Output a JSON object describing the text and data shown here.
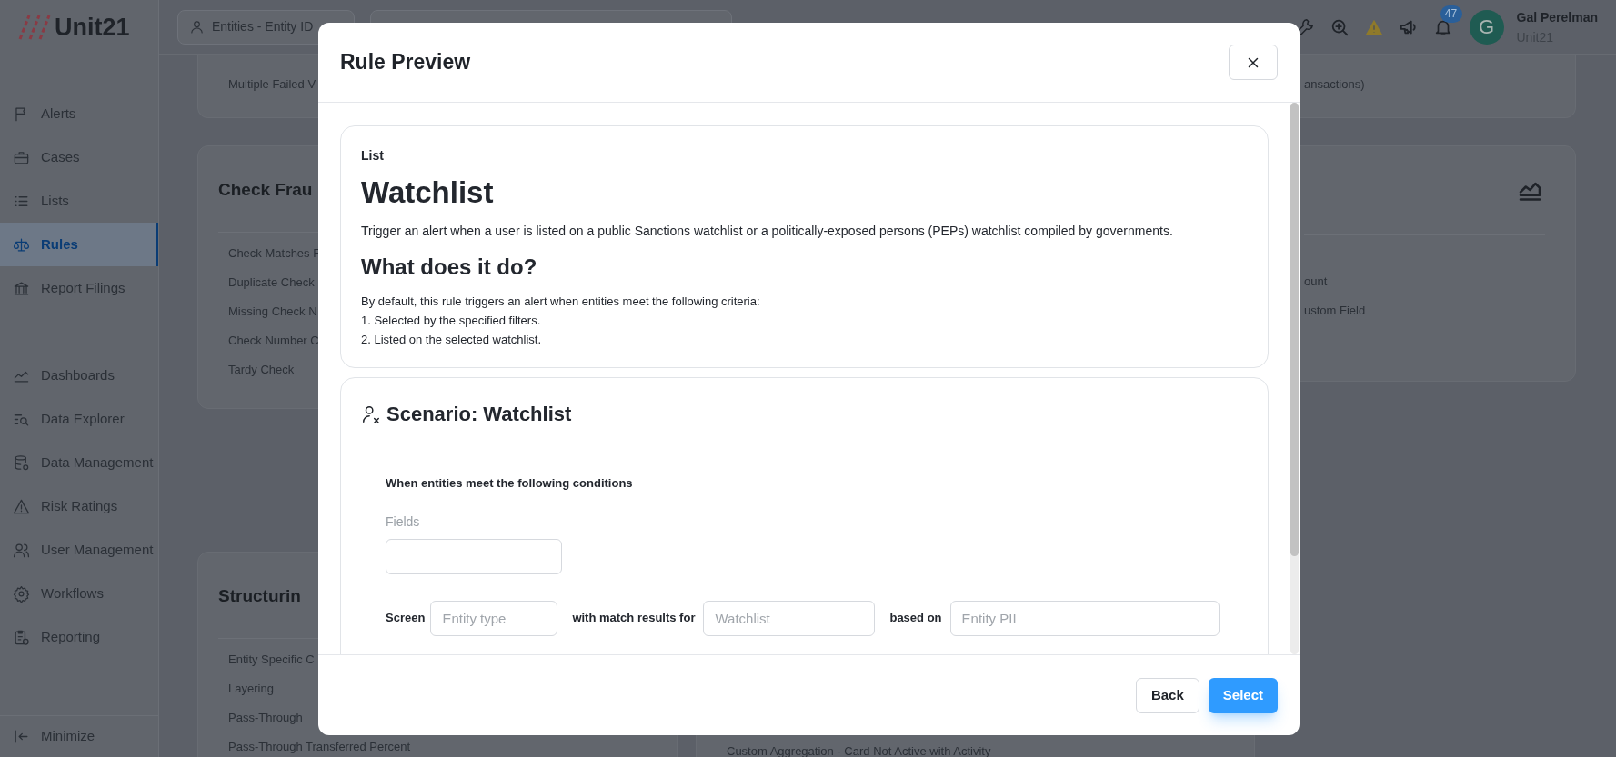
{
  "logo": {
    "text": "Unit21"
  },
  "sidebar": {
    "sections": [
      [
        {
          "label": "Alerts",
          "selected": false
        },
        {
          "label": "Cases",
          "selected": false
        },
        {
          "label": "Lists",
          "selected": false
        },
        {
          "label": "Rules",
          "selected": true
        },
        {
          "label": "Report Filings",
          "selected": false
        }
      ],
      [
        {
          "label": "Dashboards",
          "selected": false
        },
        {
          "label": "Data Explorer",
          "selected": false
        },
        {
          "label": "Data Management",
          "selected": false
        },
        {
          "label": "Risk Ratings",
          "selected": false
        },
        {
          "label": "User Management",
          "selected": false
        },
        {
          "label": "Workflows",
          "selected": false
        },
        {
          "label": "Reporting",
          "selected": false
        }
      ]
    ],
    "footer": {
      "label": "Minimize"
    }
  },
  "top_bar": {
    "entity_selector": {
      "label": "Entities - Entity ID"
    },
    "notifications": {
      "badge": "47"
    },
    "user": {
      "initial": "G",
      "name": "Gal Perelman",
      "organization": "Unit21"
    }
  },
  "background": {
    "columns": [
      {
        "cards": [
          {
            "items": [
              "Multiple Failed V"
            ]
          },
          {
            "title": "Check Frau",
            "items": [
              "Check Matches F",
              "Duplicate Check",
              "Missing Check N",
              "Check Number C",
              "Tardy Check"
            ]
          },
          {
            "title": "Structurin",
            "items": [
              "Entity Specific C",
              "Layering",
              "Pass-Through",
              "Pass-Through Transferred Percent"
            ]
          }
        ]
      },
      {
        "cards": [
          {
            "items": [
              "Custom Aggregation - Card Not Active with Activity"
            ]
          }
        ]
      },
      {
        "cards": [
          {
            "items": [
              "ansactions)"
            ]
          },
          {
            "items": [
              "ount",
              "ustom Field"
            ]
          }
        ]
      }
    ]
  },
  "modal": {
    "title": "Rule Preview",
    "sections": [
      {
        "kind": "description",
        "eyebrow": "List",
        "title": "Watchlist",
        "summary": "Trigger an alert when a user is listed on a public Sanctions watchlist or a politically-exposed persons (PEPs) watchlist compiled by governments.",
        "subtitle": "What does it do?",
        "lines": [
          "By default, this rule triggers an alert when entities meet the following criteria:",
          "1. Selected by the specified filters.",
          "2. Listed on the selected watchlist."
        ]
      },
      {
        "kind": "scenario",
        "title": "Scenario: Watchlist",
        "conditions_label": "When entities meet the following conditions",
        "fields_label": "Fields",
        "screen_row": [
          {
            "kind": "label",
            "text": "Screen"
          },
          {
            "kind": "input",
            "placeholder": "Entity type"
          },
          {
            "kind": "label",
            "text": "with match results for"
          },
          {
            "kind": "input",
            "placeholder": "Watchlist"
          },
          {
            "kind": "label",
            "text": "based on"
          },
          {
            "kind": "input",
            "placeholder": "Entity PII"
          }
        ]
      }
    ],
    "buttons": [
      {
        "label": "Back",
        "kind": "secondary"
      },
      {
        "label": "Select",
        "kind": "primary"
      }
    ]
  }
}
